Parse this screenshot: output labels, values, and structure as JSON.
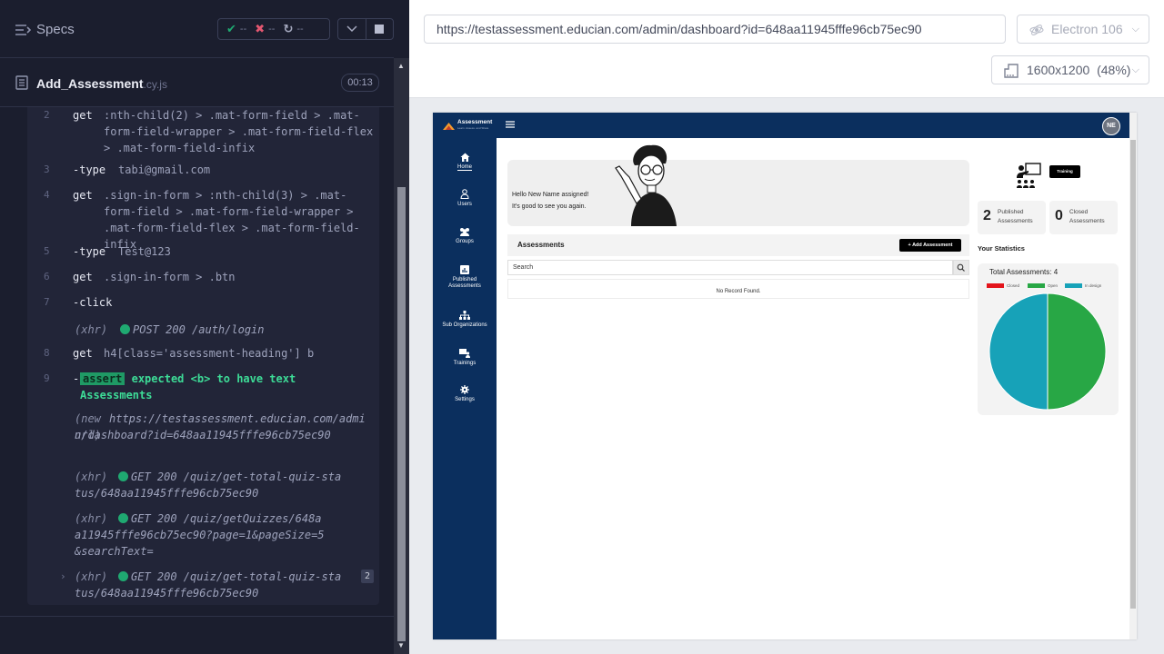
{
  "runner": {
    "specs_label": "Specs",
    "stats": {
      "passed": "--",
      "failed": "--",
      "pending": "--"
    },
    "spec_name": "Add_Assessment",
    "spec_ext": ".cy.js",
    "duration": "00:13",
    "commands": [
      {
        "num": "2",
        "name": "get",
        "text": ":nth-child(2) > .mat-form-field > .mat-form-field-wrapper > .mat-form-field-flex > .mat-form-field-infix"
      },
      {
        "num": "3",
        "name": "-type",
        "text": "tabi@gmail.com"
      },
      {
        "num": "4",
        "name": "get",
        "text": ".sign-in-form > :nth-child(3) > .mat-form-field > .mat-form-field-wrapper > .mat-form-field-flex > .mat-form-field-infix"
      },
      {
        "num": "5",
        "name": "-type",
        "text": "Test@123"
      },
      {
        "num": "6",
        "name": "get",
        "text": ".sign-in-form > .btn"
      },
      {
        "num": "7",
        "name": "-click",
        "text": ""
      },
      {
        "num": "",
        "name": "(xhr)",
        "text": "POST 200 /auth/login"
      },
      {
        "num": "8",
        "name": "get",
        "text": "h4[class='assessment-heading'] b"
      },
      {
        "num": "9",
        "name": "-",
        "badge": "assert",
        "text": "expected <b> to have text Assessments"
      },
      {
        "num": "",
        "name": "(new url)",
        "text": "https://testassessment.educian.com/admin/dashboard?id=648aa11945fffe96cb75ec90"
      },
      {
        "num": "",
        "name": "(xhr)",
        "text": "GET 200 /quiz/get-total-quiz-status/648aa11945fffe96cb75ec90"
      },
      {
        "num": "",
        "name": "(xhr)",
        "text": "GET 200 /quiz/getQuizzes/648aa11945fffe96cb75ec90?page=1&pageSize=5&searchText="
      },
      {
        "num": "",
        "name": "(xhr)",
        "text": "GET 200 /quiz/get-total-quiz-status/648aa11945fffe96cb75ec90",
        "count": "2"
      }
    ]
  },
  "aut": {
    "url": "https://testassessment.educian.com/admin/dashboard?id=648aa11945fffe96cb75ec90",
    "browser": "Electron 106",
    "viewport": "1600x1200",
    "scale": "(48%)"
  },
  "app": {
    "logo_text": "Assessment",
    "logo_sub": "Learn. Assess. and Share",
    "avatar_initials": "NE",
    "nav": [
      {
        "label": "Home",
        "icon": "home-icon"
      },
      {
        "label": "Users",
        "icon": "user-icon"
      },
      {
        "label": "Groups",
        "icon": "groups-icon"
      },
      {
        "label": "Published Assessments",
        "icon": "chart-icon"
      },
      {
        "label": "Sub Organizations",
        "icon": "org-icon"
      },
      {
        "label": "Trainings",
        "icon": "training-icon"
      },
      {
        "label": "Settings",
        "icon": "gear-icon"
      }
    ],
    "welcome_line1": "Hello New Name assigned!",
    "welcome_line2": "It's good to see you again.",
    "training_label": "Training",
    "published": {
      "count": "2",
      "label": "Published Assessments"
    },
    "closed": {
      "count": "0",
      "label": "Closed Assessments"
    },
    "stats_title": "Your Statistics",
    "assessments_title": "Assessments",
    "add_button": "Add Assessment",
    "search_placeholder": "Search",
    "no_record": "No Record Found.",
    "colors": {
      "navy": "#0b2f5e",
      "closed": "#e3141b",
      "open": "#28a745",
      "indesign": "#17a2b8"
    }
  },
  "chart_data": {
    "type": "pie",
    "title": "Total Assessments: 4",
    "categories": [
      "Closed",
      "Open",
      "In design"
    ],
    "values": [
      0,
      2,
      2
    ],
    "colors": [
      "#e3141b",
      "#28a745",
      "#17a2b8"
    ],
    "legend": "top"
  }
}
